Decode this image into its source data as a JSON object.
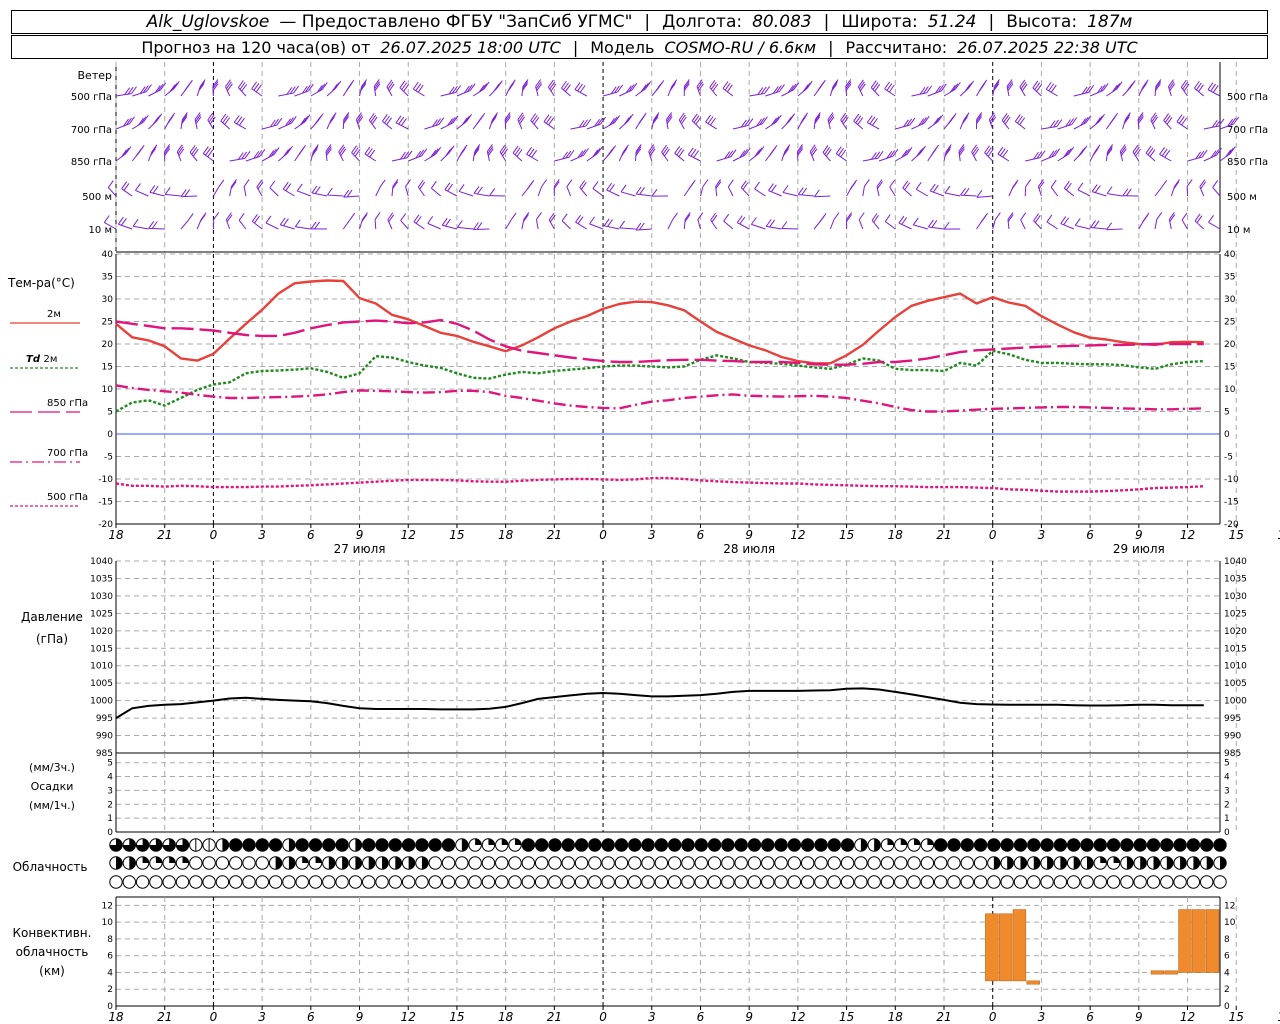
{
  "header": {
    "station": "Alk_Uglovskoe",
    "provider": "— Предоставлено ФГБУ \"ЗапСиб УГМС\"",
    "lon_label": "Долгота:",
    "lon": "80.083",
    "lat_label": "Широта:",
    "lat": "51.24",
    "alt_label": "Высота:",
    "alt": "187м",
    "forecast_prefix": "Прогноз на 120 часа(ов) от",
    "forecast_start": "26.07.2025 18:00 UTC",
    "model_label": "Модель",
    "model": "COSMO-RU / 6.6км",
    "computed_label": "Рассчитано:",
    "computed": "26.07.2025 22:38 UTC"
  },
  "chart_data": [
    {
      "type": "wind-barbs",
      "title": "Ветер",
      "levels": [
        "500 гПа",
        "700 гПа",
        "850 гПа",
        "500 м",
        "10 м"
      ],
      "color": "#7b1fd8"
    },
    {
      "type": "line",
      "title": "Тем-ра(°C)",
      "ylim": [
        -20,
        40
      ],
      "yticks": [
        -20,
        -15,
        -10,
        -5,
        0,
        5,
        10,
        15,
        20,
        25,
        30,
        35,
        40
      ],
      "x_hours": [
        18,
        19,
        20,
        21,
        22,
        23,
        0,
        1,
        2,
        3,
        4,
        5,
        6,
        7,
        8,
        9,
        10,
        11,
        12,
        13,
        14,
        15,
        16,
        17,
        18,
        19,
        20,
        21,
        22,
        23,
        0,
        1,
        2,
        3,
        4,
        5,
        6,
        7,
        8,
        9,
        10,
        11,
        12,
        13,
        14,
        15,
        16,
        17,
        18,
        19,
        20,
        21,
        22,
        23,
        0,
        1,
        2,
        3,
        4,
        5,
        6,
        7,
        8,
        9,
        10,
        11,
        12,
        13,
        14,
        15,
        16,
        17,
        18,
        19,
        20,
        21,
        22,
        23,
        0
      ],
      "series": [
        {
          "name": "2м",
          "color": "#e8403a",
          "dash": "",
          "values": [
            24.5,
            21.5,
            20.8,
            19.5,
            16.8,
            16.3,
            17.8,
            21.2,
            24.5,
            27.6,
            31.2,
            33.5,
            33.9,
            34.1,
            34.0,
            30.2,
            29.0,
            26.5,
            25.5,
            24.0,
            22.5,
            21.8,
            20.5,
            19.5,
            18.4,
            19.7,
            21.5,
            23.5,
            25.0,
            26.2,
            27.8,
            28.9,
            29.4,
            29.3,
            28.6,
            27.5,
            25.0,
            22.7,
            21.2,
            19.7,
            18.6,
            17.1,
            16.2,
            15.7,
            15.7,
            17.5,
            19.8,
            23.0,
            26.0,
            28.5,
            29.6,
            30.4,
            31.2,
            29.0,
            30.4,
            29.2,
            28.5,
            26.2,
            24.3,
            22.6,
            21.4,
            21.0,
            20.4,
            20.0,
            19.8,
            20.4,
            20.5,
            20.4
          ]
        },
        {
          "name": "Td 2м",
          "color": "#1e8a1e",
          "dash": "3,2",
          "values": [
            5.0,
            7.0,
            7.5,
            6.3,
            8.0,
            9.8,
            11.0,
            11.5,
            13.5,
            14.0,
            14.1,
            14.3,
            14.6,
            13.8,
            12.5,
            13.5,
            17.3,
            17.0,
            16.0,
            15.2,
            14.7,
            13.5,
            12.5,
            12.3,
            13.2,
            13.8,
            13.5,
            14.0,
            14.3,
            14.6,
            15.0,
            15.2,
            15.2,
            15.0,
            14.8,
            15.0,
            16.5,
            17.5,
            16.8,
            16.0,
            15.8,
            15.6,
            15.2,
            14.8,
            14.5,
            15.4,
            16.8,
            16.3,
            14.5,
            14.2,
            14.2,
            14.0,
            15.8,
            15.2,
            18.5,
            17.7,
            16.5,
            15.8,
            15.8,
            15.6,
            15.5,
            15.5,
            15.3,
            14.8,
            14.5,
            15.5,
            16.0,
            16.2
          ]
        },
        {
          "name": "850 гПа",
          "color": "#e0147c",
          "dash": "22,6",
          "values": [
            25.0,
            24.5,
            24.0,
            23.5,
            23.5,
            23.3,
            23.0,
            22.5,
            22.0,
            21.8,
            21.8,
            22.5,
            23.5,
            24.2,
            24.8,
            25.0,
            25.2,
            25.0,
            24.6,
            24.8,
            25.3,
            24.5,
            23.0,
            21.0,
            19.5,
            18.5,
            18.0,
            17.5,
            17.0,
            16.6,
            16.2,
            16.0,
            16.0,
            16.2,
            16.4,
            16.5,
            16.5,
            16.3,
            16.2,
            16.0,
            16.0,
            16.0,
            15.8,
            15.5,
            15.4,
            15.4,
            15.6,
            16.0,
            16.0,
            16.3,
            16.8,
            17.5,
            18.2,
            18.6,
            18.8,
            19.0,
            19.2,
            19.4,
            19.5,
            19.6,
            19.7,
            19.8,
            19.8,
            19.9,
            20.0,
            20.0,
            20.0,
            20.0
          ]
        },
        {
          "name": "700 гПа",
          "color": "#e0147c",
          "dash": "12,4,2,4",
          "values": [
            10.8,
            10.2,
            9.8,
            9.5,
            9.2,
            8.7,
            8.3,
            8.0,
            8.0,
            8.1,
            8.2,
            8.3,
            8.5,
            8.8,
            9.3,
            9.7,
            9.6,
            9.5,
            9.3,
            9.2,
            9.3,
            9.6,
            9.6,
            9.3,
            8.5,
            8.0,
            7.4,
            6.8,
            6.3,
            6.0,
            5.8,
            5.7,
            6.5,
            7.2,
            7.5,
            8.0,
            8.3,
            8.6,
            8.8,
            8.5,
            8.4,
            8.3,
            8.4,
            8.5,
            8.3,
            8.0,
            7.4,
            6.8,
            6.0,
            5.3,
            5.0,
            5.0,
            5.2,
            5.4,
            5.6,
            5.7,
            5.8,
            5.9,
            6.0,
            6.0,
            5.9,
            5.8,
            5.7,
            5.6,
            5.5,
            5.5,
            5.6,
            5.7
          ]
        },
        {
          "name": "500 гПа",
          "color": "#e0147c",
          "dash": "3,2",
          "values": [
            -11.0,
            -11.5,
            -11.5,
            -11.7,
            -11.5,
            -11.6,
            -11.8,
            -11.8,
            -11.8,
            -11.7,
            -11.7,
            -11.5,
            -11.4,
            -11.2,
            -11.0,
            -10.8,
            -10.6,
            -10.4,
            -10.2,
            -10.2,
            -10.2,
            -10.3,
            -10.5,
            -10.6,
            -10.6,
            -10.4,
            -10.2,
            -10.1,
            -10.0,
            -10.0,
            -10.1,
            -10.2,
            -10.1,
            -9.8,
            -9.8,
            -10.0,
            -10.3,
            -10.5,
            -10.7,
            -10.8,
            -10.9,
            -11.0,
            -11.0,
            -11.2,
            -11.3,
            -11.4,
            -11.5,
            -11.6,
            -11.6,
            -11.7,
            -11.8,
            -11.8,
            -11.8,
            -11.9,
            -12.0,
            -12.3,
            -12.4,
            -12.6,
            -12.8,
            -12.8,
            -12.8,
            -12.7,
            -12.5,
            -12.3,
            -12.0,
            -11.9,
            -11.8,
            -11.6
          ]
        }
      ]
    },
    {
      "type": "line",
      "title": "Давление",
      "unit": "(гПа)",
      "ylim": [
        985,
        1040
      ],
      "yticks": [
        985,
        990,
        995,
        1000,
        1005,
        1010,
        1015,
        1020,
        1025,
        1030,
        1035,
        1040
      ],
      "series": [
        {
          "name": "",
          "color": "#000000",
          "values": [
            995.0,
            997.8,
            998.5,
            998.8,
            999.0,
            999.5,
            1000.0,
            1000.6,
            1000.8,
            1000.5,
            1000.2,
            1000.0,
            999.8,
            999.3,
            998.5,
            997.8,
            997.6,
            997.6,
            997.6,
            997.6,
            997.5,
            997.5,
            997.5,
            997.7,
            998.2,
            999.3,
            1000.5,
            1001.0,
            1001.5,
            1002.0,
            1002.2,
            1002.0,
            1001.6,
            1001.2,
            1001.2,
            1001.4,
            1001.6,
            1002.0,
            1002.5,
            1002.8,
            1002.8,
            1002.8,
            1002.8,
            1002.9,
            1003.0,
            1003.4,
            1003.5,
            1003.2,
            1002.5,
            1001.8,
            1001.0,
            1000.2,
            999.4,
            999.0,
            998.9,
            998.8,
            998.8,
            998.8,
            998.8,
            998.7,
            998.6,
            998.6,
            998.7,
            998.8,
            998.8,
            998.7,
            998.7,
            998.7
          ]
        }
      ]
    },
    {
      "type": "bar",
      "title": "Осадки",
      "units": [
        "(мм/3ч.)",
        "(мм/1ч.)"
      ],
      "ylim": [
        0,
        5
      ],
      "yticks": [
        0,
        1,
        2,
        3,
        4,
        5
      ],
      "values": []
    },
    {
      "type": "table",
      "title": "Облачность",
      "rows": 3
    },
    {
      "type": "bar",
      "title": "Конвективн. облачность (км)",
      "ylim": [
        0,
        13
      ],
      "yticks": [
        0,
        2,
        4,
        6,
        8,
        10,
        12
      ],
      "color": "#ef8b2c",
      "bars": [
        {
          "x_index": 63,
          "base": 3.0,
          "top": 11.0
        },
        {
          "x_index": 64,
          "base": 3.0,
          "top": 11.0
        },
        {
          "x_index": 65,
          "base": 3.0,
          "top": 11.5
        },
        {
          "x_index": 66,
          "base": 2.6,
          "top": 3.0
        },
        {
          "x_index": 75,
          "base": 3.8,
          "top": 4.2
        },
        {
          "x_index": 76,
          "base": 3.8,
          "top": 4.2
        },
        {
          "x_index": 77,
          "base": 4.0,
          "top": 11.5
        },
        {
          "x_index": 78,
          "base": 4.0,
          "top": 11.5
        },
        {
          "x_index": 79,
          "base": 4.0,
          "top": 11.5
        }
      ]
    }
  ],
  "x_axis": {
    "hour_labels": [
      "18",
      "21",
      "0",
      "3",
      "6",
      "9",
      "12",
      "15",
      "18",
      "21",
      "0",
      "3",
      "6",
      "9",
      "12",
      "15",
      "18",
      "21",
      "0",
      "3",
      "6",
      "9",
      "12",
      "15",
      "18",
      "21",
      "0"
    ],
    "day_labels": [
      "27 июля",
      "28 июля",
      "29 июля"
    ]
  },
  "legend": [
    {
      "label": "2м",
      "color": "#e8403a"
    },
    {
      "label_it": "Td",
      "label": "2м",
      "color": "#1e8a1e"
    },
    {
      "label": "850 гПа",
      "color": "#e0147c"
    },
    {
      "label": "700 гПа",
      "color": "#e0147c"
    },
    {
      "label": "500 гПа",
      "color": "#e0147c"
    }
  ],
  "cloud_rows": [
    "ffffffhhHFFFFHFFFFHFFFFFFFHQQQQFFFFFFFFFFFFFFFFFFFFFFFFFHHQQQQFFFFFFFFFFFFFFFFFFFFFF",
    "HHQQQQeeeeeeHHQQHHHHHHHHeeeeeeeeeeeeeeeeeeeeeeeeeeeeeeeeeeeeeeeeeeHHHHHHHHQQHHHHHHHH",
    "eeeeeeeeeeeeeeeeeeeeeeeeeeeeeeeeeeeeeeeeeeeeeeeeeeeeeeeeeeeeeeeeeeeeeeeeeeeeeeeeeeee"
  ]
}
